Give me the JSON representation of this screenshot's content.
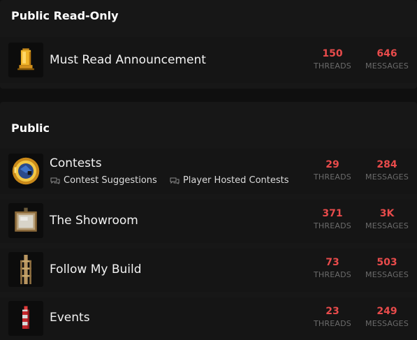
{
  "sections": [
    {
      "title": "Public Read-Only",
      "forums": [
        {
          "icon": "bell-icon",
          "title": "Must Read Announcement",
          "threads": "150",
          "messages": "646"
        }
      ]
    },
    {
      "title": "Public",
      "forums": [
        {
          "icon": "trophy-icon",
          "title": "Contests",
          "subforums": [
            "Contest Suggestions",
            "Player Hosted Contests"
          ],
          "threads": "29",
          "messages": "284"
        },
        {
          "icon": "picture-frame-icon",
          "title": "The Showroom",
          "threads": "371",
          "messages": "3K"
        },
        {
          "icon": "scaffold-icon",
          "title": "Follow My Build",
          "threads": "73",
          "messages": "503"
        },
        {
          "icon": "firework-icon",
          "title": "Events",
          "threads": "23",
          "messages": "249"
        }
      ]
    }
  ],
  "labels": {
    "threads": "THREADS",
    "messages": "MESSAGES"
  },
  "colors": {
    "accent": "#e84b4b",
    "background": "#0f0f0f",
    "section": "#171717",
    "muted": "#6b6b6b"
  }
}
